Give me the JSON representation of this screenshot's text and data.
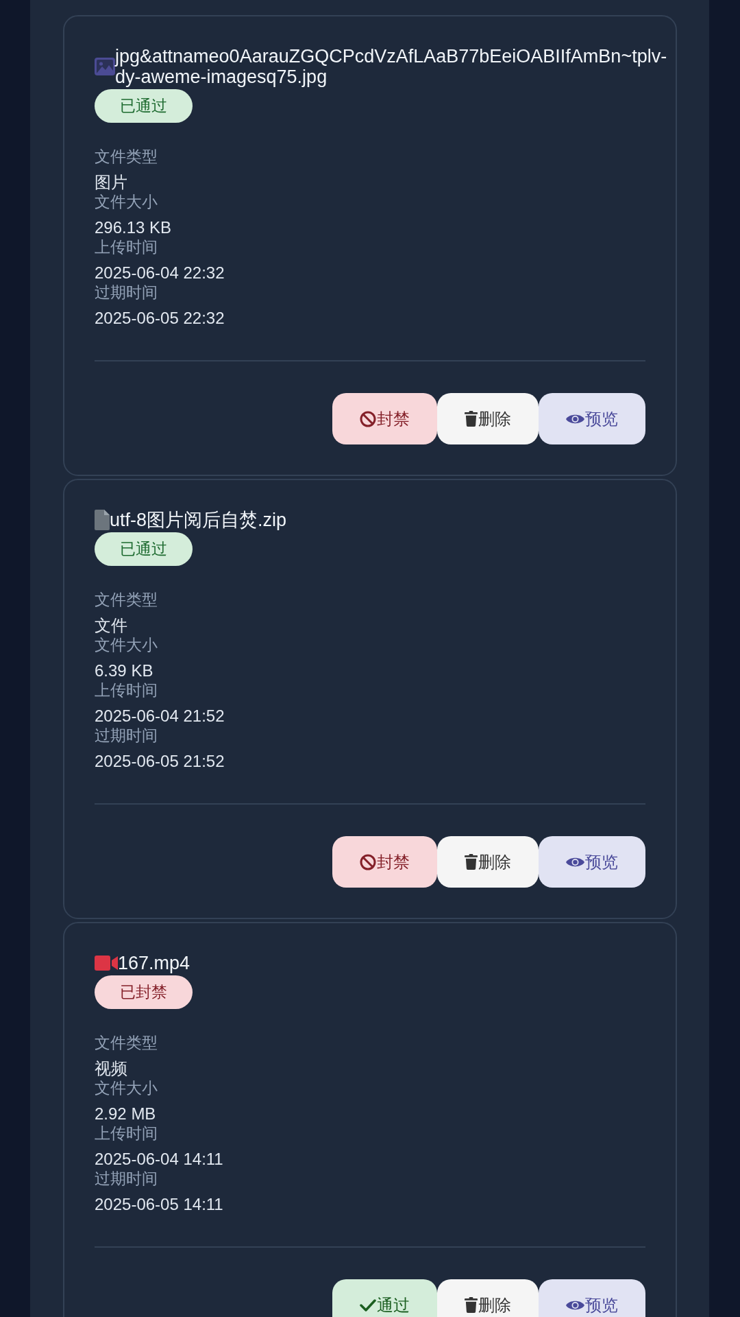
{
  "files": [
    {
      "kind": "image",
      "name": "jpg&attnameo0AarauZGQCPcdVzAfLAaB77bEeiOABIIfAmBn~tplv-dy-aweme-imagesq75.jpg",
      "status": {
        "kind": "approved",
        "label": "已通过"
      },
      "fields": [
        {
          "label": "文件类型",
          "value": "图片"
        },
        {
          "label": "文件大小",
          "value": "296.13 KB"
        },
        {
          "label": "上传时间",
          "value": "2025-06-04 22:32"
        },
        {
          "label": "过期时间",
          "value": "2025-06-05 22:32"
        }
      ],
      "actions": [
        {
          "kind": "ban",
          "label": "封禁"
        },
        {
          "kind": "delete",
          "label": "删除"
        },
        {
          "kind": "preview",
          "label": "预览"
        }
      ]
    },
    {
      "kind": "file",
      "name": "utf-8图片阅后自焚.zip",
      "status": {
        "kind": "approved",
        "label": "已通过"
      },
      "fields": [
        {
          "label": "文件类型",
          "value": "文件"
        },
        {
          "label": "文件大小",
          "value": "6.39 KB"
        },
        {
          "label": "上传时间",
          "value": "2025-06-04 21:52"
        },
        {
          "label": "过期时间",
          "value": "2025-06-05 21:52"
        }
      ],
      "actions": [
        {
          "kind": "ban",
          "label": "封禁"
        },
        {
          "kind": "delete",
          "label": "删除"
        },
        {
          "kind": "preview",
          "label": "预览"
        }
      ]
    },
    {
      "kind": "video",
      "name": "167.mp4",
      "status": {
        "kind": "banned",
        "label": "已封禁"
      },
      "fields": [
        {
          "label": "文件类型",
          "value": "视频"
        },
        {
          "label": "文件大小",
          "value": "2.92 MB"
        },
        {
          "label": "上传时间",
          "value": "2025-06-04 14:11"
        },
        {
          "label": "过期时间",
          "value": "2025-06-05 14:11"
        }
      ],
      "actions": [
        {
          "kind": "approve",
          "label": "通过"
        },
        {
          "kind": "delete",
          "label": "删除"
        },
        {
          "kind": "preview",
          "label": "预览"
        }
      ]
    }
  ]
}
